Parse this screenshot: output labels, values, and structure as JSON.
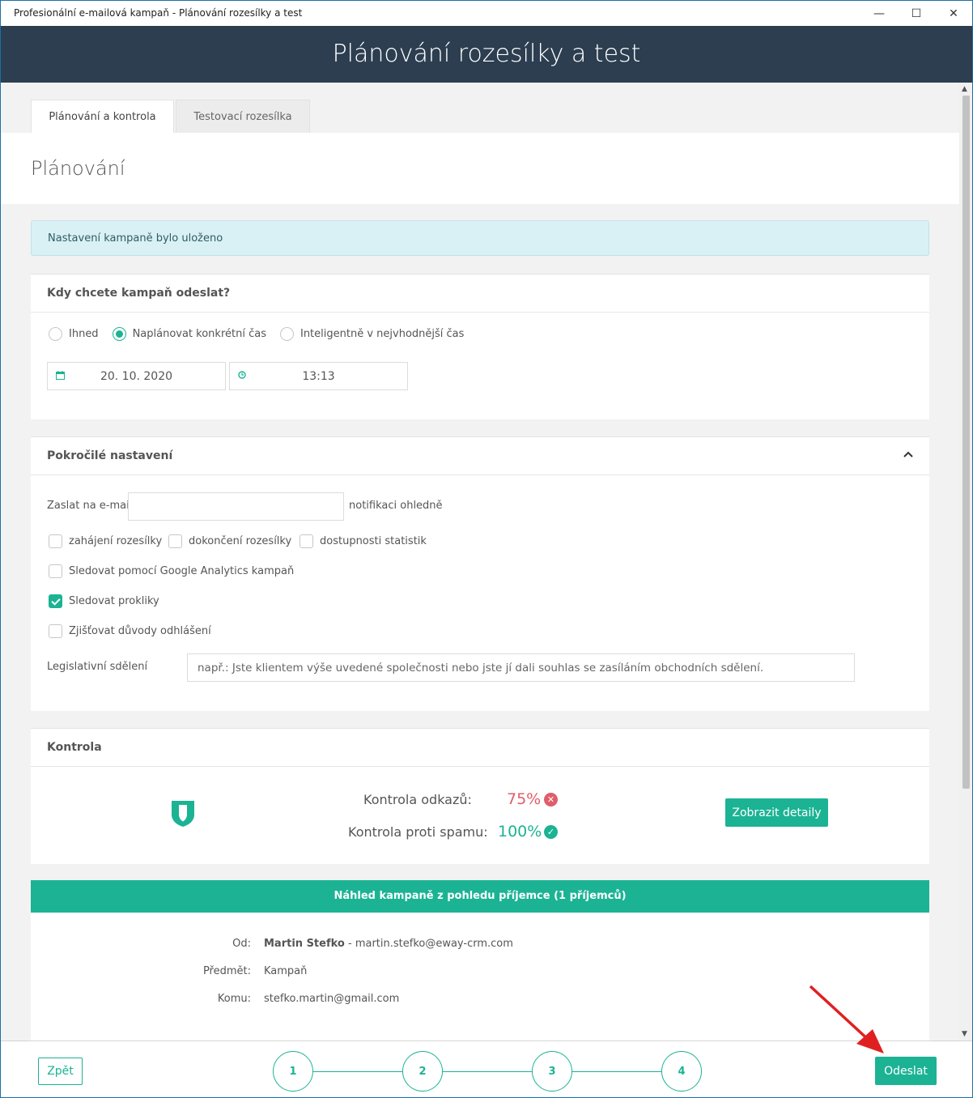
{
  "window": {
    "title": "Profesionální e-mailová kampaň - Plánování rozesílky a test",
    "minimize_label": "—",
    "maximize_label": "☐",
    "close_label": "✕"
  },
  "header": {
    "title": "Plánování rozesílky a test"
  },
  "tabs": [
    {
      "label": "Plánování a kontrola",
      "active": true
    },
    {
      "label": "Testovací rozesílka",
      "active": false
    }
  ],
  "page": {
    "heading": "Plánování"
  },
  "alert": {
    "text": "Nastavení kampaně bylo uloženo"
  },
  "schedule": {
    "heading": "Kdy chcete kampaň odeslat?",
    "options": [
      {
        "label": "Ihned",
        "checked": false
      },
      {
        "label": "Naplánovat konkrétní čas",
        "checked": true
      },
      {
        "label": "Inteligentně v nejvhodnější čas",
        "checked": false
      }
    ],
    "date": "20. 10. 2020",
    "time": "13:13"
  },
  "advanced": {
    "heading": "Pokročilé nastavení",
    "email_prefix": "Zaslat na e-mail",
    "email_value": "",
    "email_suffix": "notifikaci ohledně",
    "notify": [
      {
        "label": "zahájení rozesílky",
        "checked": false
      },
      {
        "label": "dokončení rozesílky",
        "checked": false
      },
      {
        "label": "dostupnosti statistik",
        "checked": false
      }
    ],
    "google_analytics": {
      "label": "Sledovat pomocí Google Analytics kampaň",
      "checked": false
    },
    "track_clicks": {
      "label": "Sledovat prokliky",
      "checked": true
    },
    "unsub_reasons": {
      "label": "Zjišťovat důvody odhlášení",
      "checked": false
    },
    "legal_label": "Legislativní sdělení",
    "legal_placeholder": "např.: Jste klientem výše uvedené společnosti nebo jste jí dali souhlas se zasíláním obchodních sdělení."
  },
  "check": {
    "heading": "Kontrola",
    "links_label": "Kontrola odkazů:",
    "links_value": "75%",
    "spam_label": "Kontrola proti spamu:",
    "spam_value": "100%",
    "details_button": "Zobrazit detaily"
  },
  "preview": {
    "heading": "Náhled kampaně z pohledu příjemce (1 příjemců)",
    "from_label": "Od:",
    "from_name": "Martin Stefko",
    "from_email": " - martin.stefko@eway-crm.com",
    "subject_label": "Předmět:",
    "subject_value": "Kampaň",
    "to_label": "Komu:",
    "to_value": "stefko.martin@gmail.com"
  },
  "footer": {
    "back_button": "Zpět",
    "steps": [
      "1",
      "2",
      "3",
      "4"
    ],
    "send_button": "Odeslat"
  },
  "colors": {
    "accent": "#1bb394",
    "header_bg": "#2c3e50",
    "error": "#e05d6a",
    "annotation": "#e02020"
  }
}
